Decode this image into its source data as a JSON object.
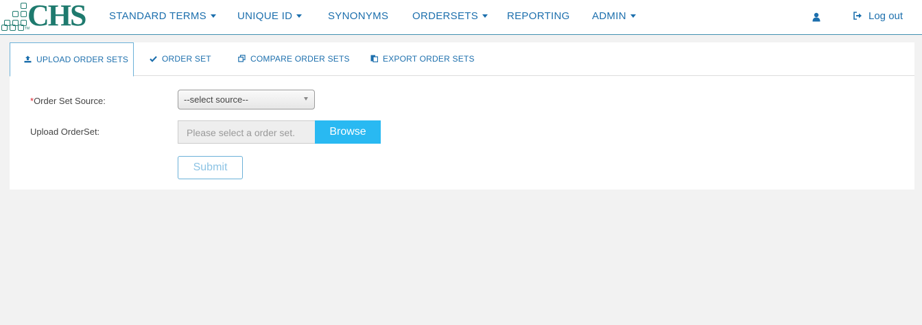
{
  "brand": {
    "name": "CHS",
    "tm": "TM"
  },
  "nav": {
    "items": [
      {
        "label": "STANDARD TERMS",
        "dropdown": true
      },
      {
        "label": "UNIQUE ID",
        "dropdown": true
      },
      {
        "label": "SYNONYMS",
        "dropdown": false
      },
      {
        "label": "ORDERSETS",
        "dropdown": true
      },
      {
        "label": "REPORTING",
        "dropdown": false
      },
      {
        "label": "ADMIN",
        "dropdown": true
      }
    ],
    "user_icon": "user-icon",
    "logout_label": "Log out",
    "logout_icon": "sign-out-icon"
  },
  "tabs": [
    {
      "label": "UPLOAD ORDER SETS",
      "icon": "upload-icon",
      "active": true
    },
    {
      "label": "ORDER SET",
      "icon": "check-icon",
      "active": false
    },
    {
      "label": "COMPARE ORDER SETS",
      "icon": "copy-icon",
      "active": false
    },
    {
      "label": "EXPORT ORDER SETS",
      "icon": "export-icon",
      "active": false
    }
  ],
  "form": {
    "required_mark": "*",
    "source_label": "Order Set Source:",
    "source_selected": "--select source--",
    "upload_label": "Upload OrderSet:",
    "upload_placeholder": "Please select a order set.",
    "browse_label": "Browse",
    "submit_label": "Submit"
  },
  "colors": {
    "accent": "#1c6fad",
    "brand": "#1e7a6e",
    "browse_bg": "#29b9f2",
    "required": "#d9232e",
    "background": "#f2f2f2"
  }
}
